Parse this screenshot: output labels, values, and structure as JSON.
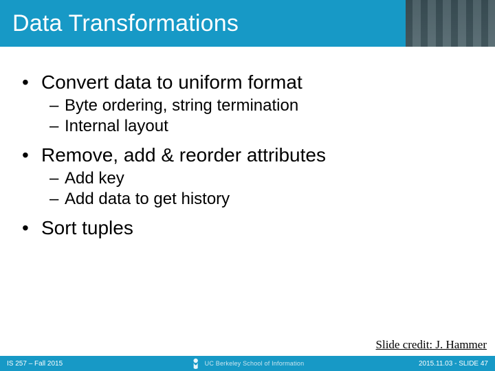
{
  "title": "Data Transformations",
  "bullets": [
    {
      "text": "Convert data to uniform format",
      "sub": [
        "Byte ordering, string termination",
        "Internal layout"
      ]
    },
    {
      "text": "Remove, add & reorder attributes",
      "sub": [
        "Add key",
        "Add data to get history"
      ]
    },
    {
      "text": "Sort tuples",
      "sub": []
    }
  ],
  "credit": "Slide credit: J. Hammer",
  "footer": {
    "left": "IS 257 – Fall 2015",
    "center": "UC Berkeley School of Information",
    "right": "2015.11.03 - SLIDE 47"
  }
}
